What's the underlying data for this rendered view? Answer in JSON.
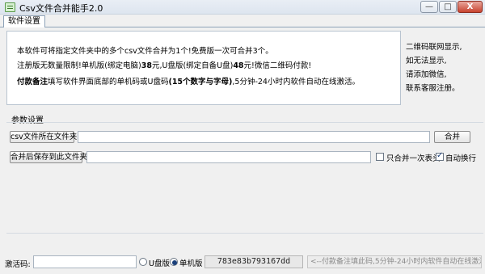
{
  "window": {
    "title": "Csv文件合并能手2.0",
    "min_label": "—",
    "max_label": "□",
    "close_label": "X"
  },
  "tabs": [
    {
      "label": "软件设置"
    }
  ],
  "info": {
    "line1": "本软件可将指定文件夹中的多个csv文件合并为1个!免费版一次可合并3个。",
    "line2_a": "注册版无数量限制!单机版(绑定电脑)",
    "line2_b": "38",
    "line2_c": "元,U盘版(绑定自备U盘)",
    "line2_d": "48",
    "line2_e": "元!微信二维码付款!",
    "line3_a": "付款备注",
    "line3_b": "填写软件界面底部的单机码或U盘码",
    "line3_c": "(15个数字与字母)",
    "line3_d": ",5分钟-24小时内软件自动在线激活。"
  },
  "contact": {
    "line1": "二维码联网显示,",
    "line2": "如无法显示,",
    "line3": "请添加微信,",
    "line4": "联系客服注册。"
  },
  "params": {
    "section_label": "参数设置",
    "csv_folder_button": "csv文件所在文件夹:",
    "csv_folder_value": "",
    "merge_button": "合并",
    "save_folder_button": "合并后保存到此文件夹:",
    "save_folder_value": "",
    "header_once_label": "只合并一次表头",
    "header_once_checked": false,
    "autowrap_label": "自动换行",
    "autowrap_checked": true
  },
  "status": {
    "activation_label": "激活码:",
    "activation_value": "",
    "radio_udisk_label": "U盘版",
    "radio_machine_label": "单机版",
    "selected_mode": "单机版",
    "machine_code": "783e83b793167dd",
    "hint": "<--付款备注填此码,5分钟-24小时内软件自动在线激活>"
  }
}
